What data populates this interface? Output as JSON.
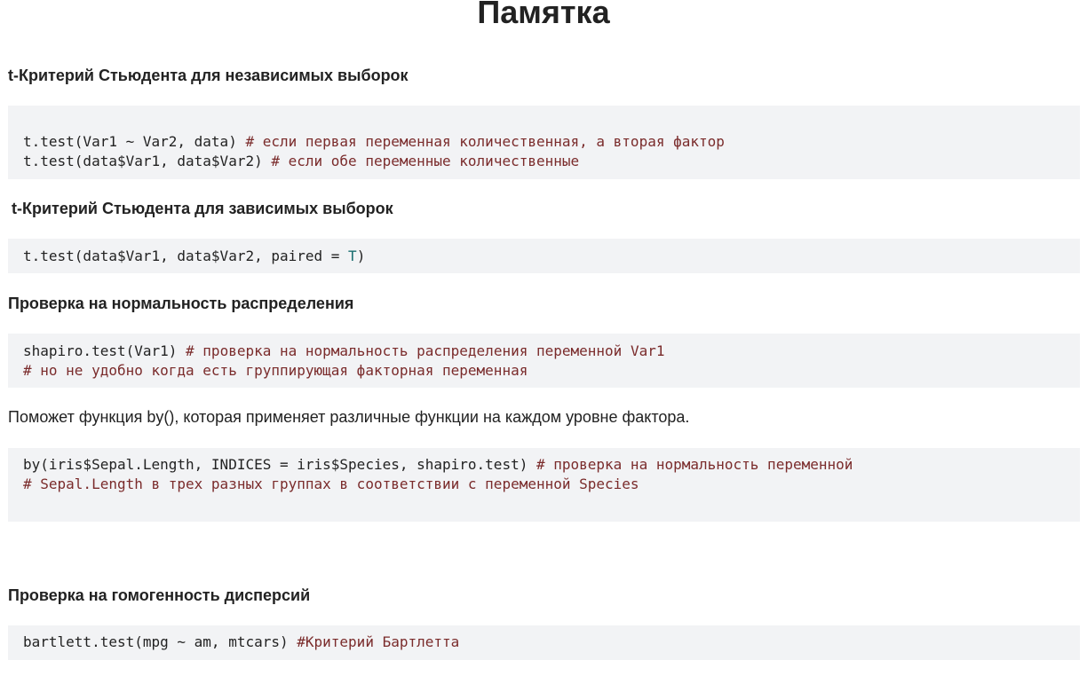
{
  "page": {
    "title": "Памятка"
  },
  "sections": {
    "ttest_independent": {
      "heading": "t-Критерий Стьюдента для независимых выборок",
      "code": {
        "line1_code": "t.test(Var1 ~ Var2, data) ",
        "line1_comment": "# если первая переменная количественная, а вторая фактор",
        "line2_code": "t.test(data$Var1, data$Var2) ",
        "line2_comment": "# если обе переменные количественные"
      }
    },
    "ttest_paired": {
      "heading": "t-Критерий Стьюдента для зависимых выборок",
      "code": {
        "line1_pre": "t.test(data$Var1, data$Var2, paired = ",
        "line1_kw": "T",
        "line1_post": ")"
      }
    },
    "normality": {
      "heading": "Проверка на нормальность распределения",
      "code": {
        "line1_code": "shapiro.test(Var1) ",
        "line1_comment": "# проверка на нормальность распределения переменной Var1",
        "line2_comment": "# но не удобно когда есть группирующая факторная переменная"
      },
      "note": "Поможет функция by(), которая применяет различные функции на каждом уровне фактора.",
      "code2": {
        "line1_code": "by(iris$Sepal.Length, INDICES = iris$Species, shapiro.test) ",
        "line1_comment": "# проверка на нормальность переменной",
        "line2_comment": "# Sepal.Length в трех разных группах в соответствии с переменной Species"
      }
    },
    "homogeneity": {
      "heading": "Проверка на гомогенность дисперсий",
      "code": {
        "line1_code": "bartlett.test(mpg ~ am, mtcars) ",
        "line1_comment": "#Критерий Бартлетта"
      }
    }
  },
  "colors": {
    "code_background": "#f2f3f5",
    "comment": "#7a2b2b",
    "keyword": "#1a6e70",
    "text": "#222222"
  }
}
